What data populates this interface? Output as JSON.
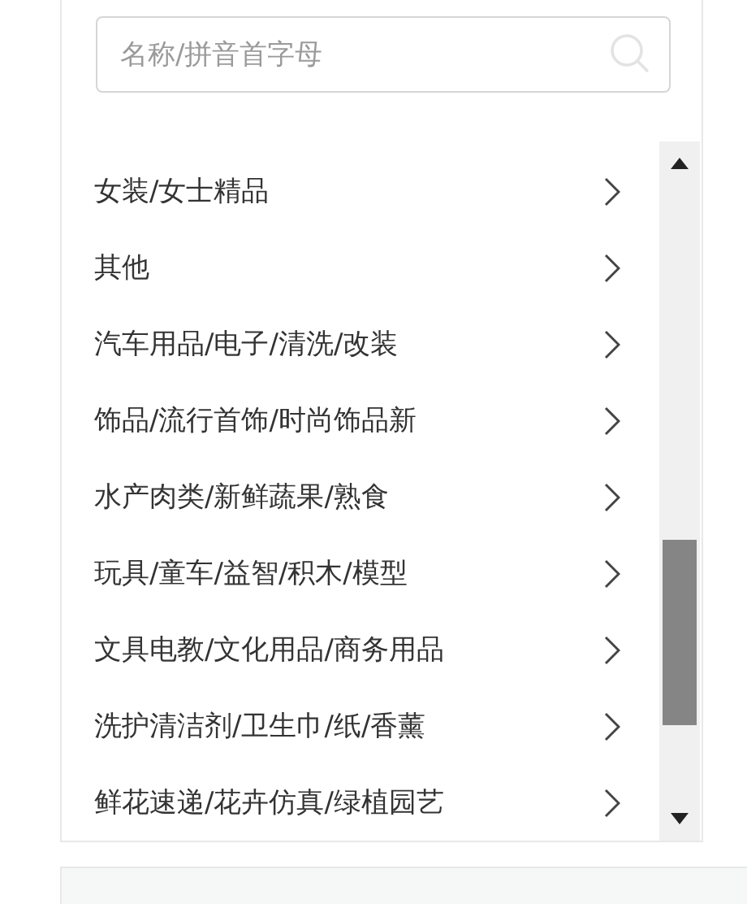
{
  "search": {
    "placeholder": "名称/拼音首字母"
  },
  "categories": [
    {
      "label": "女装/女士精品"
    },
    {
      "label": "其他"
    },
    {
      "label": "汽车用品/电子/清洗/改装"
    },
    {
      "label": "饰品/流行首饰/时尚饰品新"
    },
    {
      "label": "水产肉类/新鲜蔬果/熟食"
    },
    {
      "label": "玩具/童车/益智/积木/模型"
    },
    {
      "label": "文具电教/文化用品/商务用品"
    },
    {
      "label": "洗护清洁剂/卫生巾/纸/香薰"
    },
    {
      "label": "鲜花速递/花卉仿真/绿植园艺"
    }
  ]
}
